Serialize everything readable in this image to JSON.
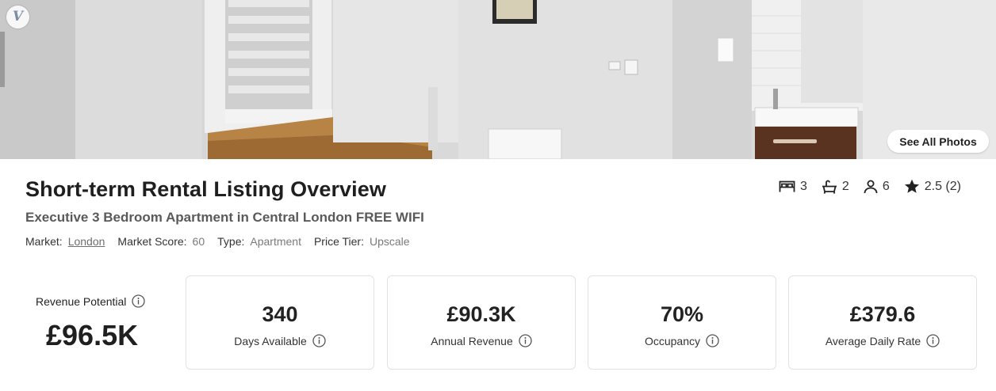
{
  "header": {
    "logo_letter": "V",
    "see_all_photos_label": "See All Photos"
  },
  "listing": {
    "page_title": "Short-term Rental Listing Overview",
    "name": "Executive 3 Bedroom Apartment in Central London FREE WIFI",
    "market_label": "Market:",
    "market_value": "London",
    "market_score_label": "Market Score:",
    "market_score_value": "60",
    "type_label": "Type:",
    "type_value": "Apartment",
    "price_tier_label": "Price Tier:",
    "price_tier_value": "Upscale"
  },
  "stats": {
    "bedrooms": "3",
    "bathrooms": "2",
    "guests": "6",
    "rating": "2.5 (2)"
  },
  "revenue_potential": {
    "label": "Revenue Potential",
    "value": "£96.5K"
  },
  "metrics": [
    {
      "value": "340",
      "label": "Days Available"
    },
    {
      "value": "£90.3K",
      "label": "Annual Revenue"
    },
    {
      "value": "70%",
      "label": "Occupancy"
    },
    {
      "value": "£379.6",
      "label": "Average Daily Rate"
    }
  ],
  "icons": {
    "bed": "bed-icon",
    "bath": "bathtub-icon",
    "guests": "person-icon",
    "rating": "star-icon",
    "info": "info-icon"
  }
}
